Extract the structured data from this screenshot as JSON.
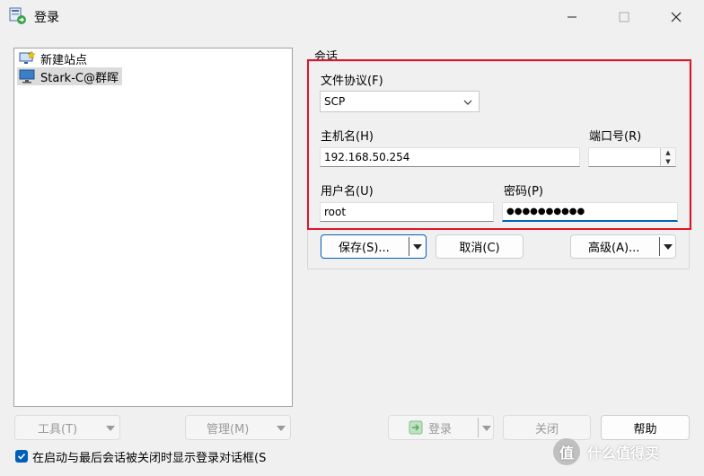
{
  "window": {
    "title": "登录",
    "icons": {
      "app": "transfer-icon",
      "minimize": "minimize-icon",
      "maximize": "maximize-icon",
      "close": "close-icon"
    }
  },
  "site_tree": {
    "items": [
      {
        "label": "新建站点",
        "icon": "new-site-icon",
        "selected": false
      },
      {
        "label": "Stark-C@群晖",
        "icon": "monitor-icon",
        "selected": true
      }
    ]
  },
  "session": {
    "group_label": "会话",
    "protocol": {
      "label": "文件协议",
      "accel": "(F)",
      "value": "SCP"
    },
    "host": {
      "label": "主机名",
      "accel": "(H)",
      "value": "192.168.50.254"
    },
    "port": {
      "label": "端口号",
      "accel": "(R)",
      "value": ""
    },
    "user": {
      "label": "用户名",
      "accel": "(U)",
      "value": "root"
    },
    "password": {
      "label": "密码",
      "accel": "(P)",
      "value": "●●●●●●●●●●"
    },
    "buttons": {
      "save": "保存(S)...",
      "cancel": "取消(C)",
      "advanced": "高级(A)..."
    }
  },
  "bottom": {
    "tools": "工具(T)",
    "manage": "管理(M)",
    "login": "登录",
    "close": "关闭",
    "help": "帮助"
  },
  "checkbox": {
    "label": "在启动与最后会话被关闭时显示登录对话框(S",
    "checked": true
  },
  "watermark": {
    "text": "什么值得买",
    "logo": "值"
  },
  "colors": {
    "accent": "#005fb8",
    "highlight_border": "#e0152a"
  }
}
